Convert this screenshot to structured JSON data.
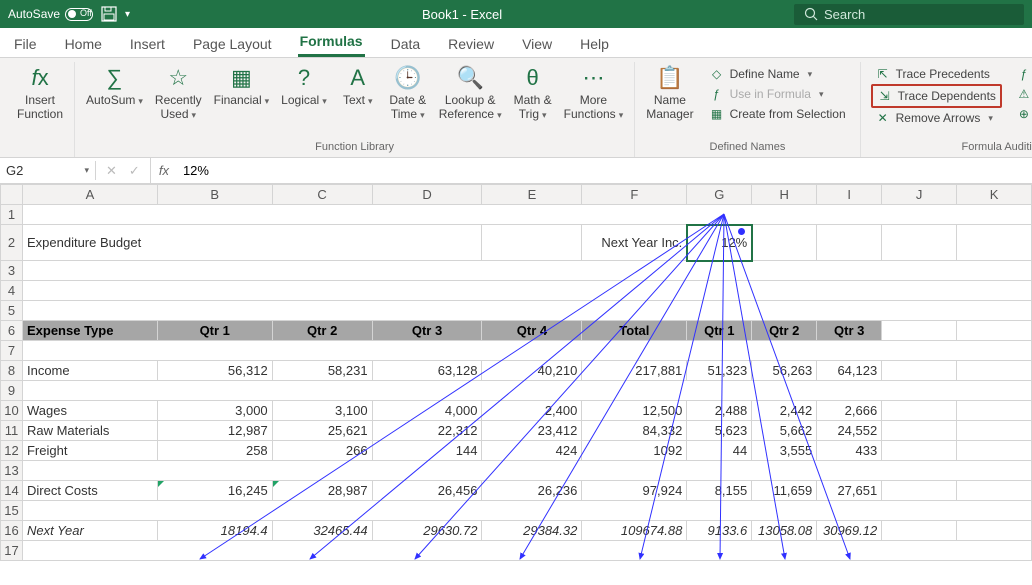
{
  "title_bar": {
    "autosave": "AutoSave",
    "autosave_state": "Off",
    "doc_title": "Book1 - Excel",
    "search_placeholder": "Search"
  },
  "tabs": [
    "File",
    "Home",
    "Insert",
    "Page Layout",
    "Formulas",
    "Data",
    "Review",
    "View",
    "Help"
  ],
  "active_tab": "Formulas",
  "ribbon": {
    "insert_function": "Insert\nFunction",
    "autosum": "AutoSum",
    "recently_used": "Recently\nUsed",
    "financial": "Financial",
    "logical": "Logical",
    "text": "Text",
    "date_time": "Date &\nTime",
    "lookup_ref": "Lookup &\nReference",
    "math_trig": "Math &\nTrig",
    "more_functions": "More\nFunctions",
    "function_library": "Function Library",
    "name_manager": "Name\nManager",
    "define_name": "Define Name",
    "use_in_formula": "Use in Formula",
    "create_from_selection": "Create from Selection",
    "defined_names": "Defined Names",
    "trace_precedents": "Trace Precedents",
    "trace_dependents": "Trace Dependents",
    "remove_arrows": "Remove Arrows",
    "show_formulas": "Show Formulas",
    "error_checking": "Error Checking",
    "evaluate_formula": "Evaluate Formula",
    "formula_auditing": "Formula Auditing"
  },
  "formula_bar": {
    "name_box": "G2",
    "value": "12%"
  },
  "columns": [
    "A",
    "B",
    "C",
    "D",
    "E",
    "F",
    "G",
    "H",
    "I",
    "J",
    "K"
  ],
  "sheet": {
    "title": "Expenditure Budget",
    "next_year_label": "Next Year Inc.",
    "next_year_value": "12%",
    "headers": [
      "Expense Type",
      "Qtr 1",
      "Qtr 2",
      "Qtr 3",
      "Qtr 4",
      "Total",
      "Qtr 1",
      "Qtr 2",
      "Qtr 3"
    ],
    "rows": [
      {
        "r": 8,
        "label": "Income",
        "vals": [
          "56,312",
          "58,231",
          "63,128",
          "40,210",
          "217,881",
          "51,323",
          "56,263",
          "64,123"
        ]
      },
      {
        "r": 10,
        "label": "Wages",
        "vals": [
          "3,000",
          "3,100",
          "4,000",
          "2,400",
          "12,500",
          "2,488",
          "2,442",
          "2,666"
        ]
      },
      {
        "r": 11,
        "label": "Raw Materials",
        "vals": [
          "12,987",
          "25,621",
          "22,312",
          "23,412",
          "84,332",
          "5,623",
          "5,662",
          "24,552"
        ]
      },
      {
        "r": 12,
        "label": "Freight",
        "vals": [
          "258",
          "266",
          "144",
          "424",
          "1092",
          "44",
          "3,555",
          "433"
        ]
      },
      {
        "r": 14,
        "label": "Direct Costs",
        "vals": [
          "16,245",
          "28,987",
          "26,456",
          "26,236",
          "97,924",
          "8,155",
          "11,659",
          "27,651"
        ]
      },
      {
        "r": 16,
        "label": "Next Year",
        "vals": [
          "18194.4",
          "32465.44",
          "29630.72",
          "29384.32",
          "109674.88",
          "9133.6",
          "13058.08",
          "30969.12"
        ],
        "italic": true
      }
    ]
  },
  "chart_data": {
    "type": "table",
    "title": "Expenditure Budget",
    "next_year_increase_pct": 12,
    "categories": [
      "Qtr 1",
      "Qtr 2",
      "Qtr 3",
      "Qtr 4",
      "Total",
      "Qtr 1",
      "Qtr 2",
      "Qtr 3"
    ],
    "series": [
      {
        "name": "Income",
        "values": [
          56312,
          58231,
          63128,
          40210,
          217881,
          51323,
          56263,
          64123
        ]
      },
      {
        "name": "Wages",
        "values": [
          3000,
          3100,
          4000,
          2400,
          12500,
          2488,
          2442,
          2666
        ]
      },
      {
        "name": "Raw Materials",
        "values": [
          12987,
          25621,
          22312,
          23412,
          84332,
          5623,
          5662,
          24552
        ]
      },
      {
        "name": "Freight",
        "values": [
          258,
          266,
          144,
          424,
          1092,
          44,
          3555,
          433
        ]
      },
      {
        "name": "Direct Costs",
        "values": [
          16245,
          28987,
          26456,
          26236,
          97924,
          8155,
          11659,
          27651
        ]
      },
      {
        "name": "Next Year",
        "values": [
          18194.4,
          32465.44,
          29630.72,
          29384.32,
          109674.88,
          9133.6,
          13058.08,
          30969.12
        ]
      }
    ]
  }
}
